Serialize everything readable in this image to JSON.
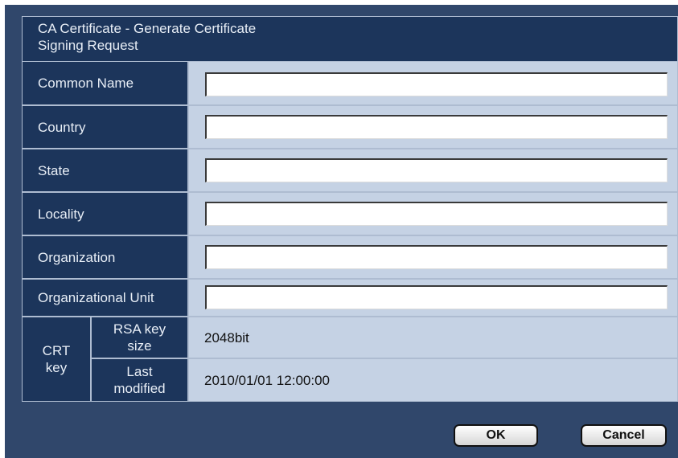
{
  "dialog": {
    "title_line1": "CA Certificate - Generate Certificate",
    "title_line2": "Signing Request"
  },
  "fields": [
    {
      "label": "Common Name",
      "value": ""
    },
    {
      "label": "Country",
      "value": ""
    },
    {
      "label": "State",
      "value": ""
    },
    {
      "label": "Locality",
      "value": ""
    },
    {
      "label": "Organization",
      "value": ""
    },
    {
      "label": "Organizational Unit",
      "value": ""
    }
  ],
  "crt_key": {
    "label_line1": "CRT",
    "label_line2": "key",
    "rsa_key_size": {
      "label_line1": "RSA key",
      "label_line2": "size",
      "value": "2048bit"
    },
    "last_modified": {
      "label_line1": "Last",
      "label_line2": "modified",
      "value": "2010/01/01 12:00:00"
    }
  },
  "buttons": {
    "ok_label": "OK",
    "cancel_label": "Cancel"
  },
  "colors": {
    "dialog_background": "#30476b",
    "label_background": "#1c355b",
    "value_background": "#c5d2e4",
    "grid": "#aebcd1"
  }
}
